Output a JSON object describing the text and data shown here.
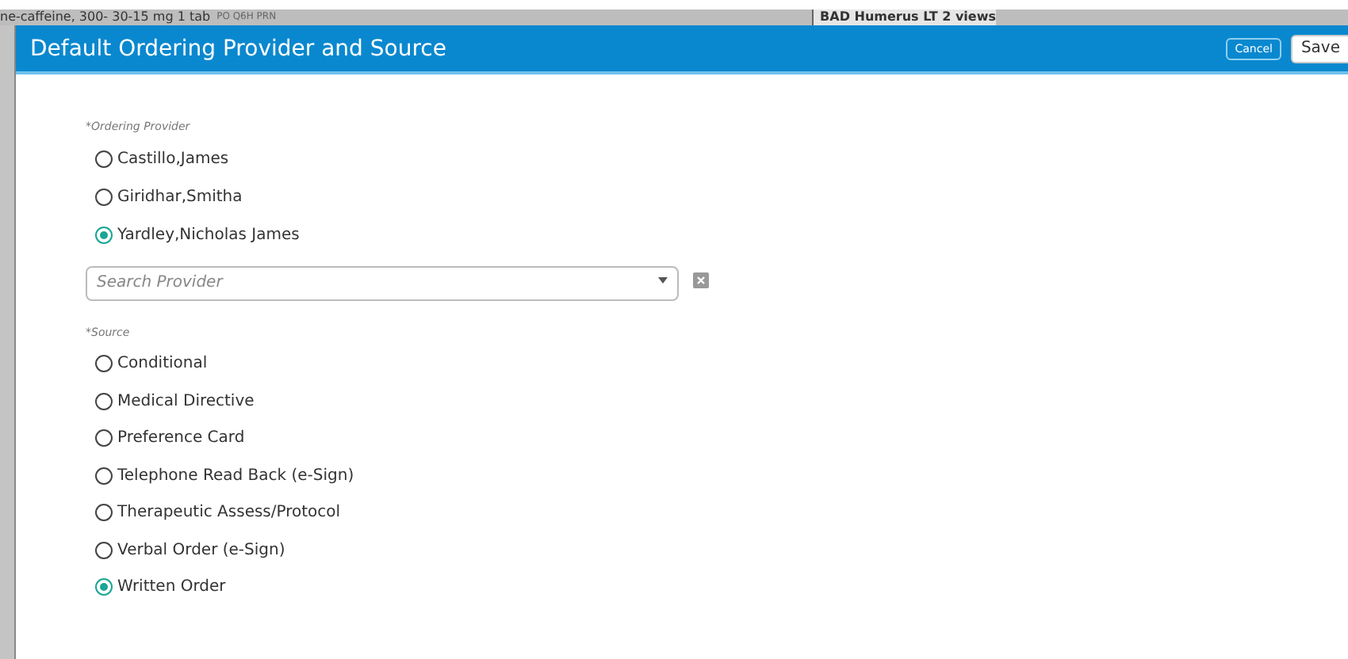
{
  "background": {
    "order_text": "ne-caffeine, 300- 30-15 mg 1 tab",
    "order_detail": "PO Q6H PRN",
    "exam_text": "BAD Humerus LT 2 views"
  },
  "dialog": {
    "title": "Default Ordering Provider and Source",
    "buttons": [
      {
        "label": "Cancel",
        "kind": "secondary"
      },
      {
        "label": "Save",
        "kind": "primary"
      }
    ]
  },
  "ordering_provider": {
    "label": "*Ordering Provider",
    "options": [
      {
        "label": "Castillo,James",
        "selected": false
      },
      {
        "label": "Giridhar,Smitha",
        "selected": false
      },
      {
        "label": "Yardley,Nicholas James",
        "selected": true
      }
    ],
    "search": {
      "placeholder": "Search Provider"
    }
  },
  "source": {
    "label": "*Source",
    "options": [
      {
        "label": "Conditional",
        "selected": false
      },
      {
        "label": "Medical Directive",
        "selected": false
      },
      {
        "label": "Preference Card",
        "selected": false
      },
      {
        "label": "Telephone Read Back (e-Sign)",
        "selected": false
      },
      {
        "label": "Therapeutic Assess/Protocol",
        "selected": false
      },
      {
        "label": "Verbal Order (e-Sign)",
        "selected": false
      },
      {
        "label": "Written Order",
        "selected": true
      }
    ]
  }
}
